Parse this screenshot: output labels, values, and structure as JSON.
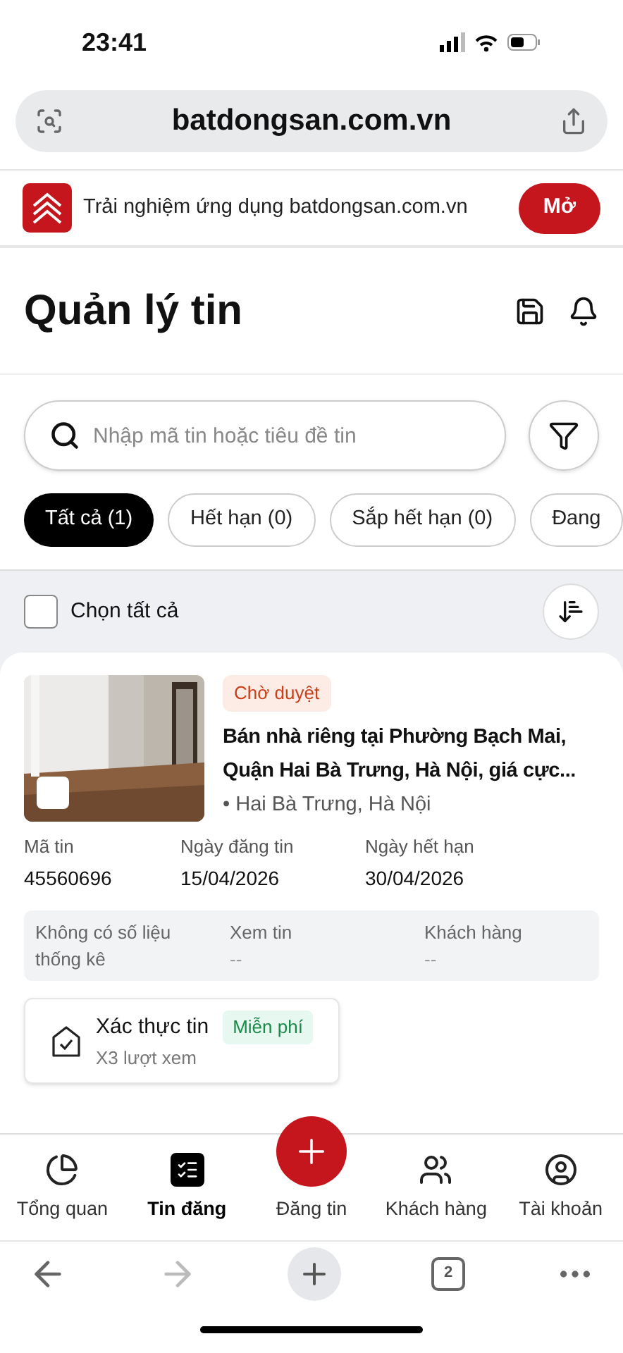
{
  "status_bar": {
    "time": "23:41"
  },
  "browser": {
    "url": "batdongsan.com.vn",
    "tab_count": "2"
  },
  "app_banner": {
    "text": "Trải nghiệm ứng dụng batdongsan.com.vn",
    "button": "Mở"
  },
  "header": {
    "title": "Quản lý tin"
  },
  "search": {
    "placeholder": "Nhập mã tin hoặc tiêu đề tin"
  },
  "tabs": [
    {
      "label": "Tất cả (1)",
      "selected": true
    },
    {
      "label": "Hết hạn (0)",
      "selected": false
    },
    {
      "label": "Sắp hết hạn (0)",
      "selected": false
    },
    {
      "label": "Đang",
      "selected": false
    }
  ],
  "select_all": {
    "label": "Chọn tất cả",
    "checked": false
  },
  "listing": {
    "kind": "picture",
    "checked": false,
    "status": "Chờ duyệt",
    "title": "Bán nhà riêng tại Phường Bạch Mai, Quận Hai Bà Trưng, Hà Nội, giá cực...",
    "location": "• Hai Bà Trưng, Hà Nội",
    "fields": [
      {
        "label": "Mã tin",
        "value": "45560696"
      },
      {
        "label": "Ngày đăng tin",
        "value": "15/04/2026"
      },
      {
        "label": "Ngày hết hạn",
        "value": "30/04/2026"
      }
    ],
    "stats": [
      {
        "label": "Không có số liệu thống kê"
      },
      {
        "label": "Xem tin",
        "value": "--"
      },
      {
        "label": "Khách hàng",
        "value": "--"
      }
    ],
    "verify": {
      "title": "Xác thực tin",
      "badge": "Miễn phí",
      "subtitle": "X3 lượt xem"
    }
  },
  "bottom_nav": [
    {
      "label": "Tổng quan",
      "kind": "overview",
      "selected": false
    },
    {
      "label": "Tin đăng",
      "kind": "listings",
      "selected": true
    },
    {
      "label": "Đăng tin",
      "kind": "post",
      "selected": false
    },
    {
      "label": "Khách hàng",
      "kind": "customers",
      "selected": false
    },
    {
      "label": "Tài khoản",
      "kind": "account",
      "selected": false
    }
  ]
}
